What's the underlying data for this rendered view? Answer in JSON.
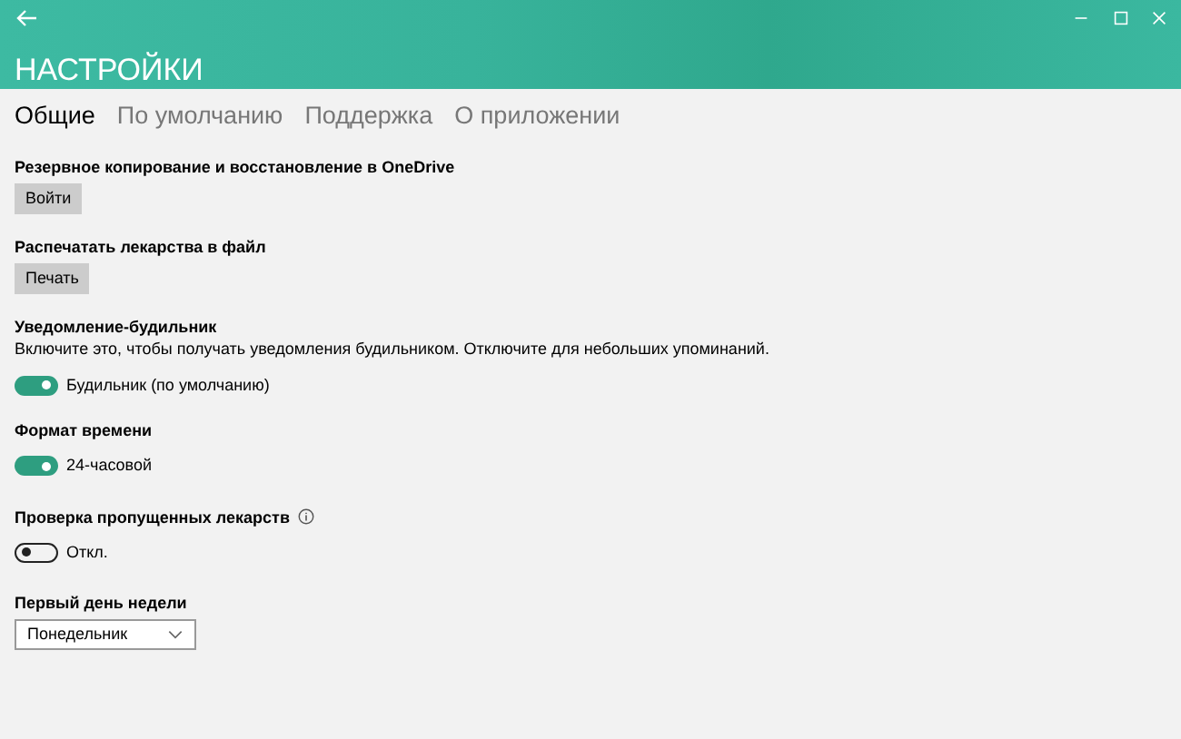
{
  "window": {
    "title": "НАСТРОЙКИ"
  },
  "tabs": [
    {
      "label": "Общие",
      "selected": true
    },
    {
      "label": "По умолчанию",
      "selected": false
    },
    {
      "label": "Поддержка",
      "selected": false
    },
    {
      "label": "О приложении",
      "selected": false
    }
  ],
  "sections": [
    {
      "kind": "button",
      "title": "Резервное копирование и восстановление в OneDrive",
      "button": "Войти"
    },
    {
      "kind": "button",
      "title": "Распечатать лекарства в файл",
      "button": "Печать"
    },
    {
      "kind": "toggle",
      "title": "Уведомление-будильник",
      "description": "Включите это, чтобы получать уведомления будильником. Отключите для небольших упоминаний.",
      "on": true,
      "state_label": "Будильник (по умолчанию)"
    },
    {
      "kind": "toggle",
      "title": "Формат времени",
      "on": true,
      "state_label": "24-часовой"
    },
    {
      "kind": "toggle",
      "title": "Проверка пропущенных лекарств",
      "info": true,
      "on": false,
      "state_label": "Откл."
    },
    {
      "kind": "dropdown",
      "title": "Первый день недели",
      "value": "Понедельник"
    }
  ]
}
